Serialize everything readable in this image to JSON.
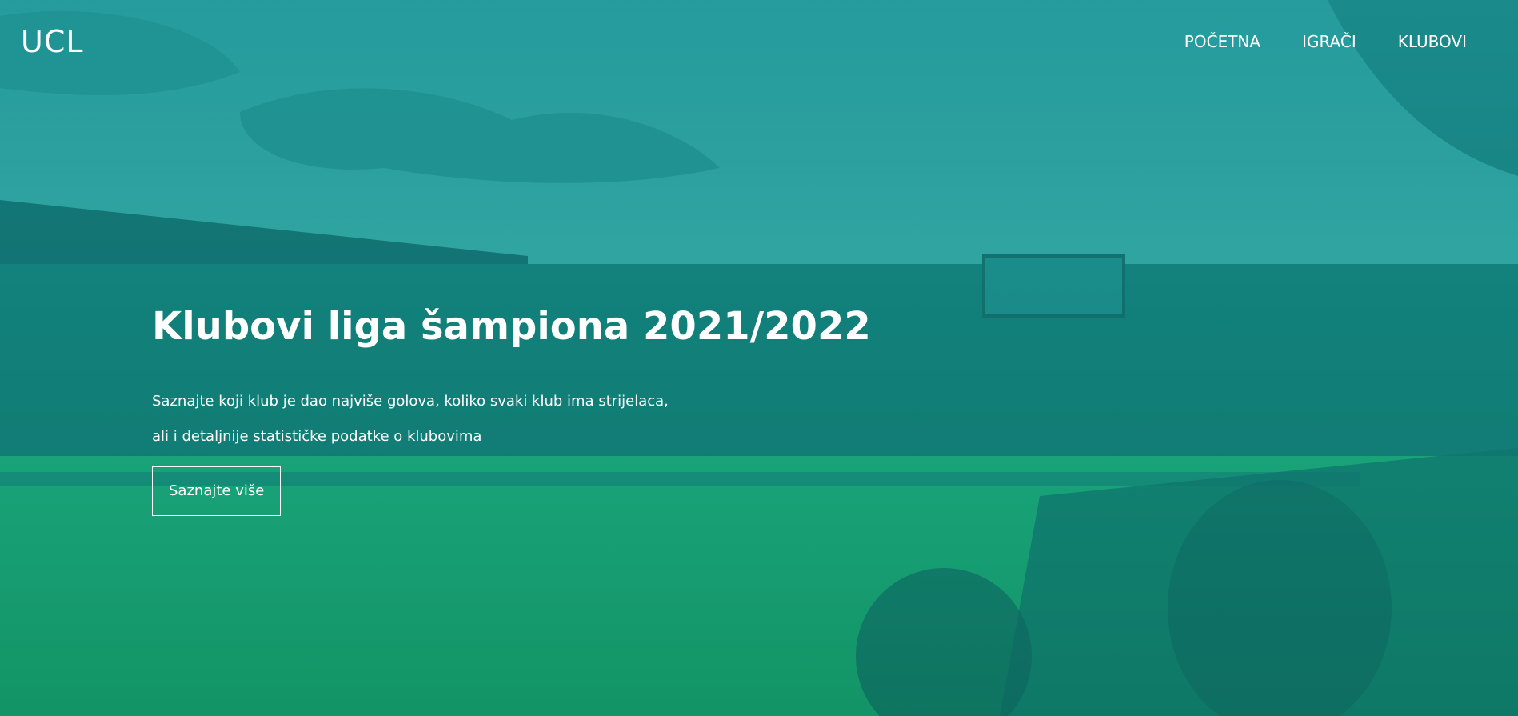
{
  "header": {
    "brand": "UCL",
    "nav": [
      {
        "label": "POČETNA"
      },
      {
        "label": "IGRAČI"
      },
      {
        "label": "KLUBOVI"
      }
    ]
  },
  "hero": {
    "title": "Klubovi liga šampiona 2021/2022",
    "description_line1": "Saznajte koji klub je dao najviše golova, koliko svaki klub ima strijelaca,",
    "description_line2": "ali i detaljnije statističke podatke o klubovima",
    "cta_label": "Saznajte više",
    "background_image": "stadium-photo",
    "overlay_color": "#1fa59a"
  }
}
